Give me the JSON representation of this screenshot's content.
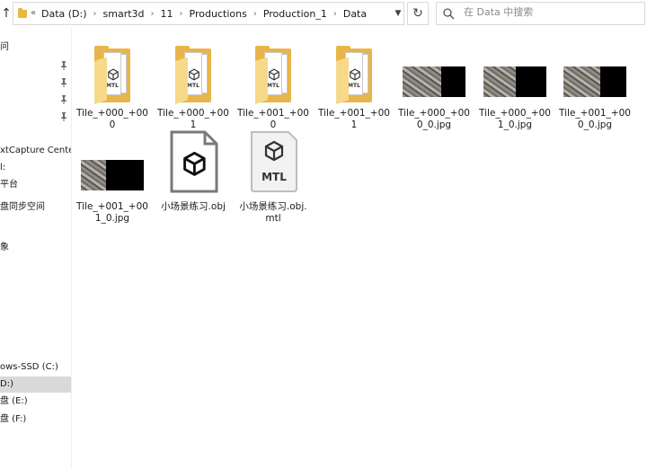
{
  "address_bar": {
    "overflow": "«",
    "crumbs": [
      "Data (D:)",
      "smart3d",
      "11",
      "Productions",
      "Production_1",
      "Data"
    ],
    "separator": "›"
  },
  "search": {
    "placeholder": "在 Data 中搜索"
  },
  "nav": {
    "items": [
      {
        "label": "问",
        "pinned": false
      },
      {
        "label": "",
        "pinned": true
      },
      {
        "label": "",
        "pinned": true
      },
      {
        "label": "",
        "pinned": true
      },
      {
        "label": "",
        "pinned": true
      },
      {
        "label": "xtCapture Center",
        "pinned": false
      },
      {
        "label": "l:",
        "pinned": false
      },
      {
        "label": "平台",
        "pinned": false
      },
      {
        "label": "盘同步空间",
        "pinned": false
      },
      {
        "label": "象",
        "pinned": false
      },
      {
        "label": "ows-SSD (C:)",
        "pinned": false
      },
      {
        "label": "D:)",
        "pinned": false,
        "selected": true
      },
      {
        "label": "盘 (E:)",
        "pinned": false
      },
      {
        "label": "盘 (F:)",
        "pinned": false
      }
    ]
  },
  "files": [
    {
      "name": "Tile_+000_+000",
      "type": "folder"
    },
    {
      "name": "Tile_+000_+001",
      "type": "folder"
    },
    {
      "name": "Tile_+001_+000",
      "type": "folder"
    },
    {
      "name": "Tile_+001_+001",
      "type": "folder"
    },
    {
      "name": "Tile_+000_+000_0.jpg",
      "type": "image",
      "city_fraction": 0.62
    },
    {
      "name": "Tile_+000_+001_0.jpg",
      "type": "image",
      "city_fraction": 0.52
    },
    {
      "name": "Tile_+001_+000_0.jpg",
      "type": "image",
      "city_fraction": 0.58
    },
    {
      "name": "Tile_+001_+001_0.jpg",
      "type": "image",
      "city_fraction": 0.4
    },
    {
      "name": "小场景练习.obj",
      "type": "obj"
    },
    {
      "name": "小场景练习.obj.mtl",
      "type": "mtl",
      "icon_text": "MTL"
    }
  ],
  "folder_icon_text": "MTL",
  "colors": {
    "folder": "#e8b54a",
    "selected": "#d9d9d9"
  }
}
